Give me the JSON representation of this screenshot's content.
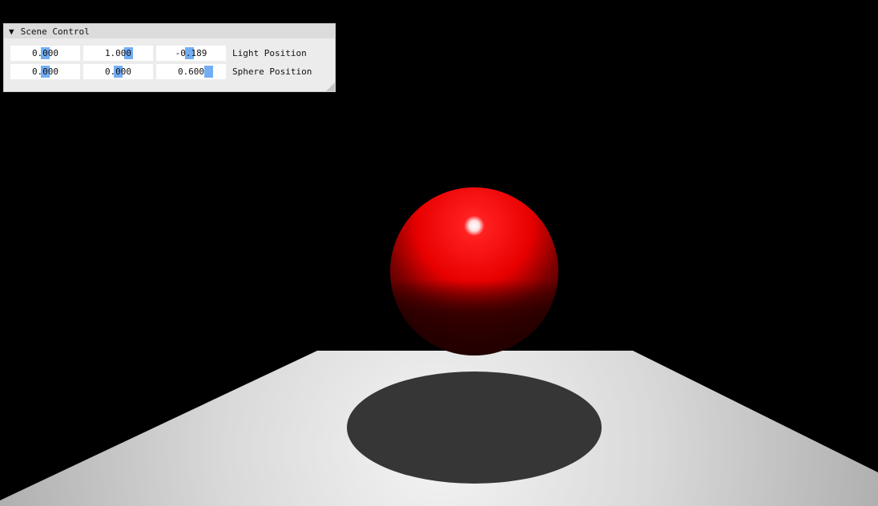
{
  "panel": {
    "title": "Scene Control",
    "rows": [
      {
        "label": "Light Position",
        "sliders": [
          {
            "value": "0.000",
            "fraction": 0.5
          },
          {
            "value": "1.000",
            "fraction": 0.68
          },
          {
            "value": "-0.189",
            "fraction": 0.47
          }
        ]
      },
      {
        "label": "Sphere Position",
        "sliders": [
          {
            "value": "0.000",
            "fraction": 0.5
          },
          {
            "value": "0.000",
            "fraction": 0.5
          },
          {
            "value": "0.600",
            "fraction": 0.8
          }
        ]
      }
    ]
  },
  "icons": {
    "collapse": "triangle-down-icon",
    "resize": "resize-grip-icon"
  },
  "colors": {
    "background": "#000000",
    "sphere": "#ff1010",
    "slider_grab": "#73aef5",
    "shadow": "#363636"
  }
}
